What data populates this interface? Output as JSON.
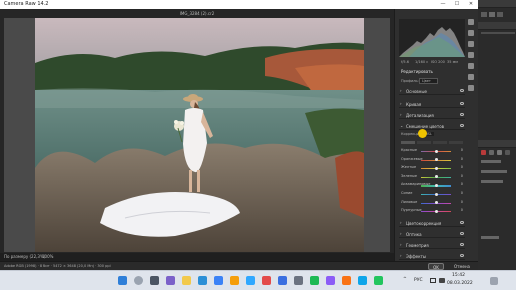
{
  "window": {
    "title": "Camera Raw 14.2",
    "min": "—",
    "max": "☐",
    "close": "✕"
  },
  "document": {
    "filename": "IMG_3284 (2).cr2"
  },
  "colors": {
    "accent": "#f0c400",
    "panel_bg": "#2f2f2f",
    "canvas_bg": "#4a4a4a",
    "taskbar_bg": "#dfe4ec"
  },
  "histogram": {
    "info": [
      "f/5.6",
      "1/160 с",
      "ISO 200",
      "35 мм"
    ]
  },
  "panel": {
    "header": "Редактировать",
    "profile_label": "Профиль:",
    "profile_value": "Цвет",
    "sections_top": [
      {
        "label": "Основные",
        "chev": "›"
      },
      {
        "label": "Кривая",
        "chev": "›"
      },
      {
        "label": "Детализация",
        "chev": "›"
      }
    ],
    "mixer": {
      "label": "Смешение цветов",
      "chev": "⌄",
      "mode_label": "Коррекция",
      "mode_value": "HSL",
      "sliders": [
        {
          "name": "Красные",
          "value": "0",
          "knob": 0.5,
          "gradient": [
            "#7c6aa8",
            "#d34a4a",
            "#d48b3a"
          ]
        },
        {
          "name": "Оранжевые",
          "value": "0",
          "knob": 0.5,
          "gradient": [
            "#c9463e",
            "#d88a3a",
            "#d9c63c"
          ]
        },
        {
          "name": "Желтые",
          "value": "0",
          "knob": 0.5,
          "gradient": [
            "#d58a38",
            "#d9cf3c",
            "#7cc24a"
          ]
        },
        {
          "name": "Зеленые",
          "value": "0",
          "knob": 0.5,
          "gradient": [
            "#c8c63c",
            "#4cae4c",
            "#3fb2a0"
          ]
        },
        {
          "name": "Аквамариновые",
          "value": "0",
          "knob": 0.5,
          "gradient": [
            "#4caf50",
            "#3fb8b4",
            "#3f8ad0"
          ]
        },
        {
          "name": "Синие",
          "value": "0",
          "knob": 0.5,
          "gradient": [
            "#3fb4b0",
            "#3d6ed0",
            "#7a4ec8"
          ]
        },
        {
          "name": "Лиловые",
          "value": "0",
          "knob": 0.5,
          "gradient": [
            "#3e6ad0",
            "#8a4ccc",
            "#c24aa8"
          ]
        },
        {
          "name": "Пурпурные",
          "value": "0",
          "knob": 0.5,
          "gradient": [
            "#8a4ccc",
            "#c94aa2",
            "#d04a5a"
          ]
        }
      ]
    },
    "sections_bottom": [
      {
        "label": "Цветокоррекция",
        "chev": "›"
      },
      {
        "label": "Оптика",
        "chev": "›"
      },
      {
        "label": "Геометрия",
        "chev": "›"
      },
      {
        "label": "Эффекты",
        "chev": "›"
      }
    ]
  },
  "zoombar": {
    "fit": "По размеру (22,3%)",
    "zoom": "100%"
  },
  "footer": {
    "left_text": "Adobe RGB (1998) · 8 бит · 5472 × 3648 (20,0 Мп) · 300 ppi",
    "ok": "OK",
    "cancel": "Отмена"
  },
  "taskbar": {
    "lang": "РУС",
    "time": "15:42",
    "date": "08.03.2022",
    "tray_arrow": "^"
  }
}
